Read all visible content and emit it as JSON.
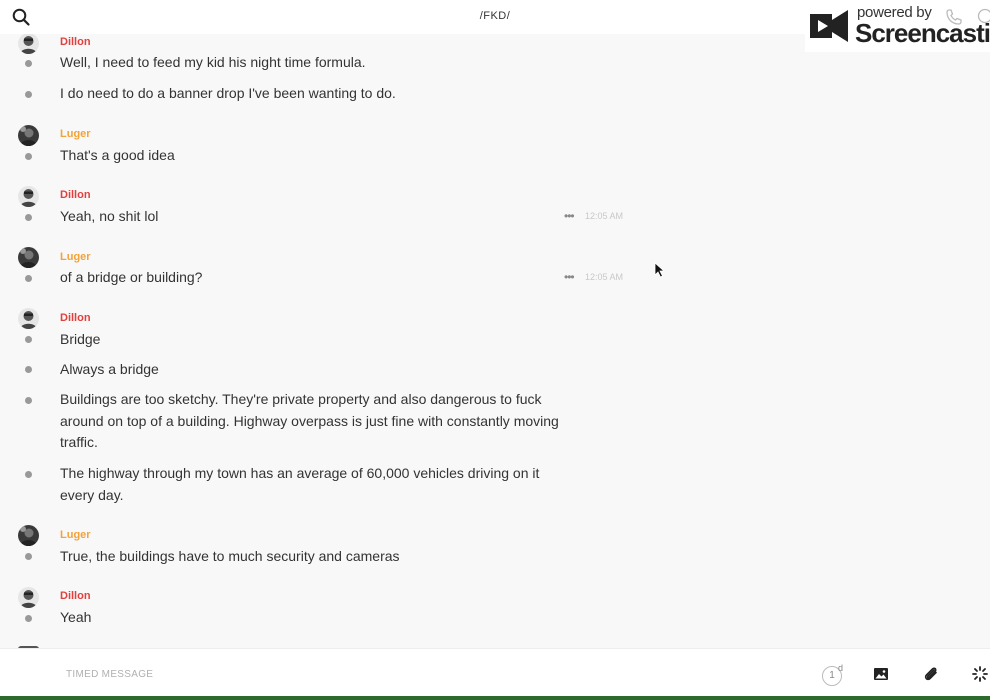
{
  "header": {
    "channel_title": "/FKD/"
  },
  "watermark": {
    "powered_by": "powered by",
    "brand": "Screencastify"
  },
  "users": {
    "dillon": {
      "name": "Dillon",
      "color": "#e0403e"
    },
    "luger": {
      "name": "Luger",
      "color": "#f2a33a"
    }
  },
  "messages": [
    {
      "author": "Dillon",
      "text": "Well, I need to feed my kid his night time formula."
    },
    {
      "author": "Dillon",
      "text": "I do need to do a banner drop I've been wanting to do."
    },
    {
      "author": "Luger",
      "text": "That's a good idea"
    },
    {
      "author": "Dillon",
      "text": "Yeah, no shit lol",
      "time": "12:05 AM"
    },
    {
      "author": "Luger",
      "text": "of a bridge or building?",
      "time": "12:05 AM"
    },
    {
      "author": "Dillon",
      "text": "Bridge"
    },
    {
      "author": "Dillon",
      "text": "Always a bridge"
    },
    {
      "author": "Dillon",
      "text": "Buildings are too sketchy. They're private property and also dangerous to fuck around on top of a building. Highway overpass is just fine with constantly moving traffic."
    },
    {
      "author": "Dillon",
      "text": "The highway through my town has an average of 60,000 vehicles driving on it every day."
    },
    {
      "author": "Luger",
      "text": "True, the buildings have to much security and cameras"
    },
    {
      "author": "Dillon",
      "text": "Yeah"
    }
  ],
  "composer": {
    "placeholder": "TIMED MESSAGE",
    "timer_value": "1",
    "timer_unit": "d"
  },
  "icons": {
    "search": "search-icon",
    "more": "more-dots-icon",
    "image": "image-icon",
    "attach": "paperclip-icon",
    "spinner": "spinner-icon"
  }
}
